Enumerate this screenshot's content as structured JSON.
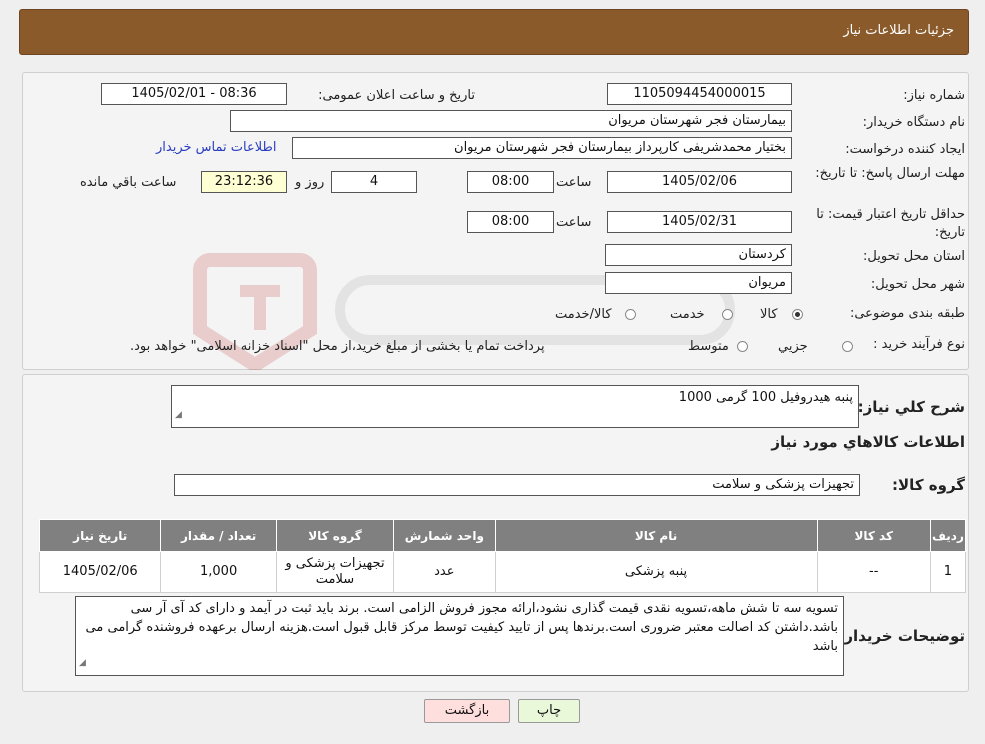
{
  "header": {
    "title": "جزئیات اطلاعات نیاز"
  },
  "form": {
    "need_number_label": "شماره نیاز:",
    "need_number": "1105094454000015",
    "announce_label": "تاریخ و ساعت اعلان عمومی:",
    "announce_value": "1405/02/01 - 08:36",
    "buyer_org_label": "نام دستگاه خریدار:",
    "buyer_org": "بیمارستان فجر شهرستان مریوان",
    "creator_label": "ایجاد کننده درخواست:",
    "creator": "بختیار محمدشریفی کارپرداز بیمارستان فجر شهرستان مریوان",
    "contact_link": "اطلاعات تماس خریدار",
    "deadline_label": "مهلت ارسال پاسخ: تا تاریخ:",
    "deadline_date": "1405/02/06",
    "time_label": "ساعت",
    "deadline_time": "08:00",
    "days_value": "4",
    "days_label": "روز و",
    "remaining_time": "23:12:36",
    "remaining_label": "ساعت باقي مانده",
    "validity_label": "حداقل تاریخ اعتبار قیمت: تا تاریخ:",
    "validity_date": "1405/02/31",
    "validity_time": "08:00",
    "province_label": "استان محل تحویل:",
    "province": "کردستان",
    "city_label": "شهر محل تحویل:",
    "city": "مریوان",
    "category_label": "طبقه بندی موضوعی:",
    "category_options": [
      "کالا",
      "خدمت",
      "کالا/خدمت"
    ],
    "process_label": "نوع فرآیند خرید :",
    "process_options": [
      "جزیي",
      "متوسط"
    ],
    "process_note": "پرداخت تمام یا بخشی از مبلغ خرید،از محل \"اسناد خزانه اسلامی\" خواهد بود."
  },
  "details": {
    "summary_label": "شرح کلي نياز:",
    "summary_value": "پنبه هیدروفیل 100 گرمی  1000",
    "goods_info_title": "اطلاعات کالاهاي مورد نياز",
    "goods_group_label": "گروه کالا:",
    "goods_group_value": "تجهیزات پزشکی و سلامت",
    "table": {
      "headers": [
        "رديف",
        "کد کالا",
        "نام کالا",
        "واحد شمارش",
        "گروه کالا",
        "تعداد / مقدار",
        "تاريخ نياز"
      ],
      "rows": [
        [
          "1",
          "--",
          "پنبه پزشکی",
          "عدد",
          "تجهیزات پزشکی و سلامت",
          "1,000",
          "1405/02/06"
        ]
      ]
    },
    "buyer_notes_label": "توضيحات خريدار:",
    "buyer_notes": "تسویه سه تا شش ماهه،تسویه نقدی قیمت گذاری نشود،ارائه مجوز فروش الزامی است. برند باید ثبت در آیمد و دارای کد آی آر سی باشد.داشتن کد اصالت معتبر ضروری است.برندها پس از تایید کیفیت توسط مرکز قابل قبول است.هزینه ارسال برعهده فروشنده گرامی می باشد"
  },
  "buttons": {
    "print": "چاپ",
    "back": "بازگشت"
  },
  "colors": {
    "header": "#8b5a2b",
    "table_header": "#808080",
    "print_btn": "#e8f8d8",
    "back_btn": "#ffdede"
  }
}
